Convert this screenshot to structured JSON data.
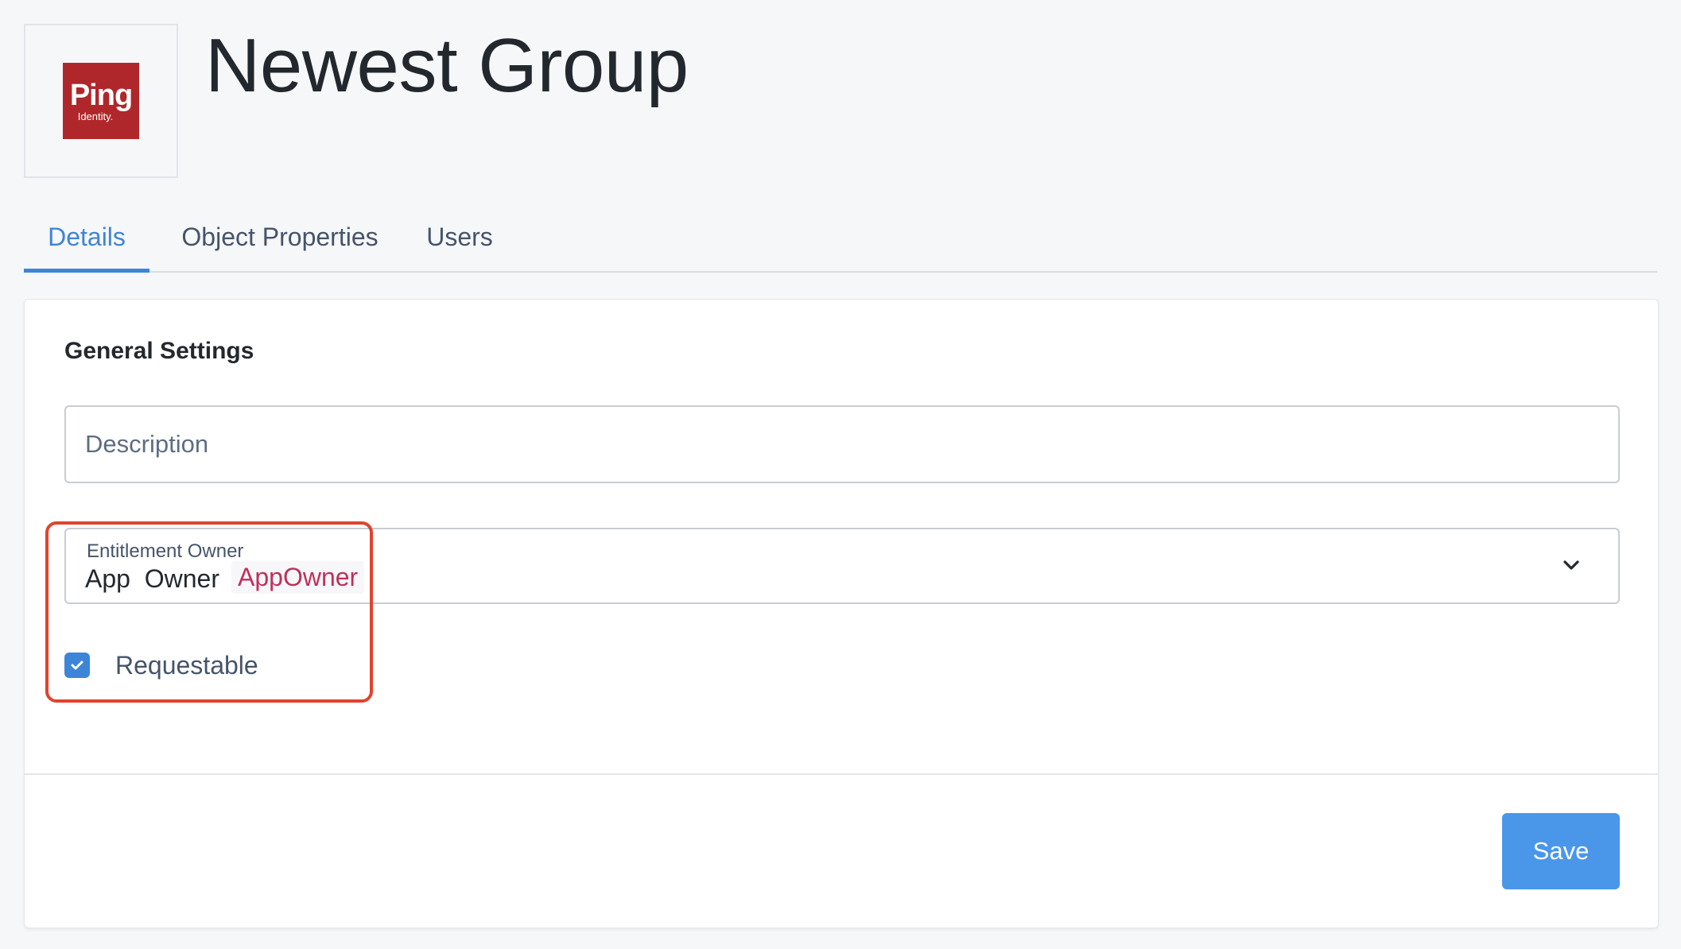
{
  "header": {
    "logo": {
      "brand": "Ping",
      "sub": "Identity.",
      "color": "#b0272b"
    },
    "title": "Newest Group"
  },
  "tabs": [
    {
      "label": "Details",
      "active": true
    },
    {
      "label": "Object Properties",
      "active": false
    },
    {
      "label": "Users",
      "active": false
    }
  ],
  "general_settings": {
    "title": "General Settings",
    "description": {
      "placeholder": "Description",
      "value": ""
    },
    "entitlement_owner": {
      "label": "Entitlement Owner",
      "value": "App  Owner",
      "tag": "AppOwner",
      "icon": "chevron-down-icon"
    },
    "requestable": {
      "label": "Requestable",
      "checked": true,
      "icon": "check-icon"
    }
  },
  "actions": {
    "save_label": "Save"
  },
  "colors": {
    "accent": "#3d85d8",
    "save_button": "#4a97ea",
    "highlight": "#e0432f",
    "tag_text": "#c0305a"
  }
}
